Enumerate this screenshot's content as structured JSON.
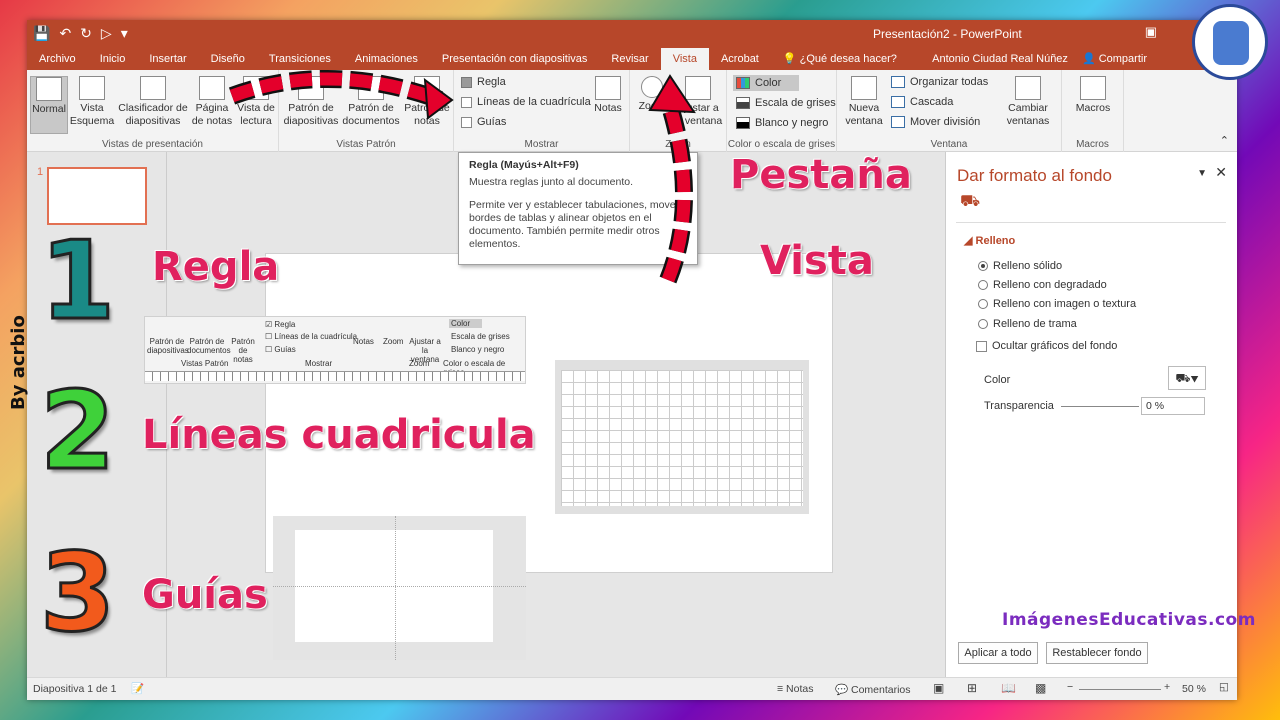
{
  "window": {
    "title": "Presentación2 - PowerPoint",
    "user": "Antonio Ciudad Real Núñez",
    "share": "Compartir"
  },
  "tabs": [
    "Archivo",
    "Inicio",
    "Insertar",
    "Diseño",
    "Transiciones",
    "Animaciones",
    "Presentación con diapositivas",
    "Revisar",
    "Vista",
    "Acrobat"
  ],
  "active_tab": "Vista",
  "tellme": "¿Qué desea hacer?",
  "ribbon": {
    "vistas_presentacion": {
      "label": "Vistas de presentación",
      "buttons": [
        "Normal",
        "Vista Esquema",
        "Clasificador de diapositivas",
        "Página de notas",
        "Vista de lectura"
      ]
    },
    "vistas_patron": {
      "label": "Vistas Patrón",
      "buttons": [
        "Patrón de diapositivas",
        "Patrón de documentos",
        "Patrón de notas"
      ]
    },
    "mostrar": {
      "label": "Mostrar",
      "checks": [
        {
          "label": "Regla",
          "checked": true
        },
        {
          "label": "Líneas de la cuadrícula",
          "checked": false
        },
        {
          "label": "Guías",
          "checked": false
        }
      ],
      "notas": "Notas"
    },
    "zoom": {
      "label": "Zoom",
      "zoom": "Zoom",
      "fit": "Ajustar a la ventana"
    },
    "color": {
      "label": "Color o escala de grises",
      "options": [
        "Color",
        "Escala de grises",
        "Blanco y negro"
      ]
    },
    "ventana": {
      "label": "Ventana",
      "nueva": "Nueva ventana",
      "options": [
        "Organizar todas",
        "Cascada",
        "Mover división"
      ],
      "cambiar": "Cambiar ventanas"
    },
    "macros": {
      "label": "Macros",
      "button": "Macros"
    }
  },
  "tooltip": {
    "title": "Regla (Mayús+Alt+F9)",
    "line1": "Muestra reglas junto al documento.",
    "body": "Permite ver y establecer tabulaciones, mover bordes de tablas y alinear objetos en el documento. También permite medir otros elementos."
  },
  "thumbnails": {
    "number": "1"
  },
  "format_pane": {
    "title": "Dar formato al fondo",
    "section": "Relleno",
    "options": [
      "Relleno sólido",
      "Relleno con degradado",
      "Relleno con imagen o textura",
      "Relleno de trama"
    ],
    "hide": "Ocultar gráficos del fondo",
    "color_label": "Color",
    "transparency_label": "Transparencia",
    "transparency_value": "0 %",
    "apply_all": "Aplicar a todo",
    "reset": "Restablecer fondo"
  },
  "status": {
    "slide": "Diapositiva 1 de 1",
    "notes": "Notas",
    "comments": "Comentarios",
    "zoom": "50 %"
  },
  "annotations": {
    "pestana": "Pestaña",
    "vista": "Vista",
    "regla": "Regla",
    "lineas": "Líneas cuadricula",
    "guias": "Guías",
    "num1": "1",
    "num2": "2",
    "num3": "3",
    "byline": "By acrbio",
    "watermark": "ImágenesEducativas.com"
  },
  "snippet": {
    "buttons": [
      "Patrón de diapositivas",
      "Patrón de documentos",
      "Patrón de notas"
    ],
    "group_patron": "Vistas Patrón",
    "checks": [
      "Regla",
      "Líneas de la cuadrícula",
      "Guías"
    ],
    "notas": "Notas",
    "group_mostrar": "Mostrar",
    "zoom": "Zoom",
    "fit": "Ajustar a la ventana",
    "group_zoom": "Zoom",
    "colors": [
      "Color",
      "Escala de grises",
      "Blanco y negro"
    ],
    "group_color": "Color o escala de grises"
  },
  "colors": {
    "accent": "#b7472a",
    "annotation": "#e0215e",
    "num1": "#1a8a86",
    "num2": "#3fd13a",
    "num3": "#f25a1c"
  }
}
